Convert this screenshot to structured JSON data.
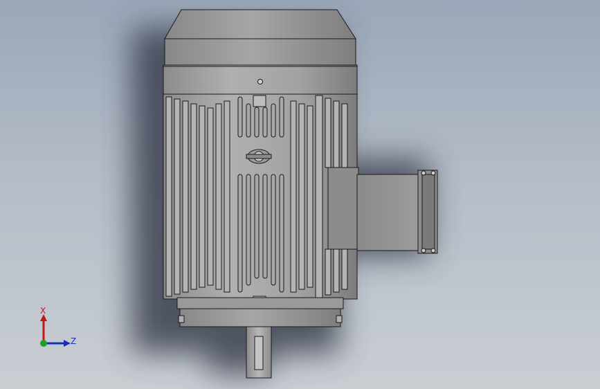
{
  "viewport": {
    "background_top": "#9aa7b8",
    "background_bottom": "#c9ced3"
  },
  "model": {
    "part_color": "#9a9a9a",
    "edge_color": "#1a1a1a",
    "shadow_color": "#3a4150"
  },
  "triad": {
    "x_label": "X",
    "z_label": "Z",
    "x_color": "#c01818",
    "z_color": "#1a2fb5",
    "y_color": "#1fa02b"
  }
}
